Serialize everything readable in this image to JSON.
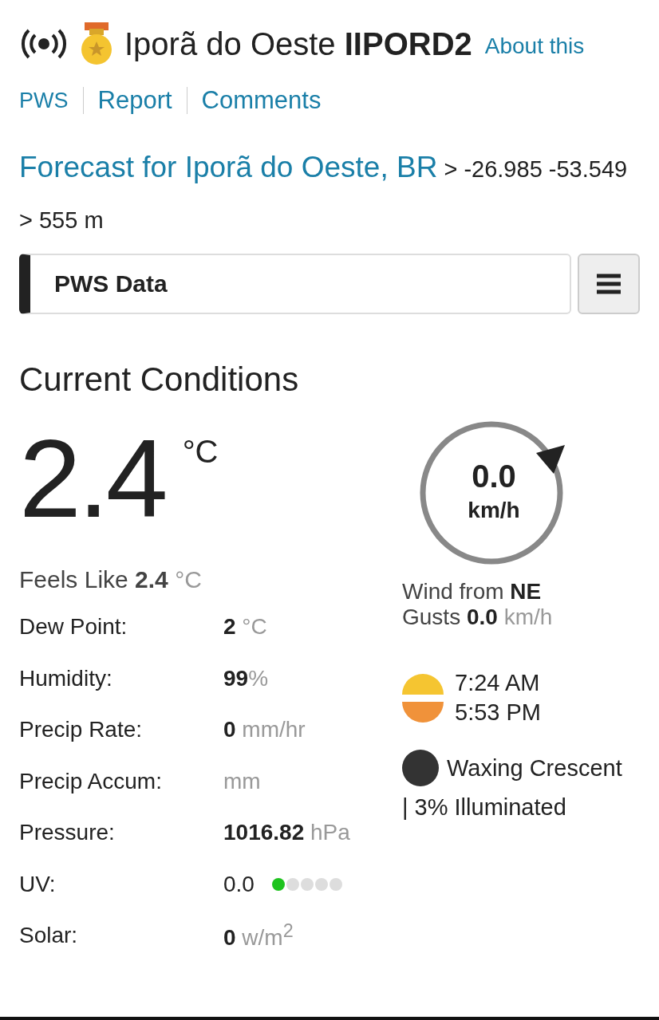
{
  "header": {
    "station_name": "Iporã do Oeste",
    "station_id": "IIPORD2",
    "about_link": "About this"
  },
  "nav_links": [
    "PWS",
    "Report",
    "Comments"
  ],
  "forecast": {
    "link": "Forecast for Iporã do Oeste, BR",
    "coords": "> -26.985 -53.549 > 555 m"
  },
  "section_bar": {
    "title": "PWS Data"
  },
  "current": {
    "title": "Current Conditions",
    "temperature": "2.4",
    "temperature_unit": "°C",
    "feels_like": {
      "label": "Feels Like",
      "value": "2.4",
      "unit": "°C"
    },
    "rows": [
      {
        "kind": "plain",
        "label": "Dew Point:",
        "value": "2",
        "unit": "°C"
      },
      {
        "kind": "plain",
        "label": "Humidity:",
        "value": "99",
        "unit": "%"
      },
      {
        "kind": "plain",
        "label": "Precip Rate:",
        "value": "0",
        "unit": "mm/hr"
      },
      {
        "kind": "plain",
        "label": "Precip Accum:",
        "unit": "mm"
      },
      {
        "kind": "plain",
        "label": "Pressure:",
        "value": "1016.82",
        "unit": "hPa"
      },
      {
        "kind": "uv",
        "label": "UV:",
        "value": "0.0",
        "dots": [
          {
            "color": "#1ec31e"
          },
          {
            "color": "#dddddd"
          },
          {
            "color": "#dddddd"
          },
          {
            "color": "#dddddd"
          },
          {
            "color": "#dddddd"
          }
        ]
      },
      {
        "kind": "plain",
        "label": "Solar:",
        "value": "0",
        "unit": "w/m$^{2}$"
      }
    ],
    "wind": {
      "speed": "0.0",
      "unit": "km/h",
      "from_label": "Wind from",
      "direction": "NE",
      "gusts": {
        "label": "Gusts",
        "value": "0.0",
        "unit": "km/h"
      }
    },
    "sun": {
      "sunrise": "7:24 AM",
      "sunset": "5:53 PM"
    },
    "moon": {
      "phase": "Waxing Crescent",
      "illumination": "| 3% Illuminated"
    }
  }
}
